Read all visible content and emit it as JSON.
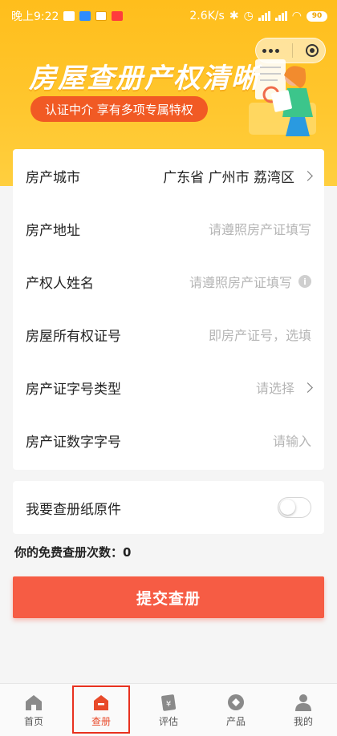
{
  "status_bar": {
    "time": "晚上9:22",
    "network_speed": "2.6K/s",
    "battery": "90"
  },
  "banner": {
    "title": "房屋查册产权清晰",
    "subtitle": "认证中介 享有多项专属特权"
  },
  "form": {
    "rows": [
      {
        "label": "房产城市",
        "value": "广东省 广州市 荔湾区",
        "filled": true
      },
      {
        "label": "房产地址",
        "placeholder": "请遵照房产证填写"
      },
      {
        "label": "产权人姓名",
        "placeholder": "请遵照房产证填写"
      },
      {
        "label": "房屋所有权证号",
        "placeholder": "即房产证号，选填"
      },
      {
        "label": "房产证字号类型",
        "placeholder": "请选择"
      },
      {
        "label": "房产证数字字号",
        "placeholder": "请输入"
      }
    ]
  },
  "toggle": {
    "label": "我要查册纸原件",
    "on": false
  },
  "free_count_text": "你的免费查册次数：0",
  "submit_label": "提交查册",
  "tabbar": {
    "items": [
      {
        "label": "首页",
        "icon": "home-icon"
      },
      {
        "label": "查册",
        "icon": "house-check-icon",
        "active": true
      },
      {
        "label": "评估",
        "icon": "yen-card-icon"
      },
      {
        "label": "产品",
        "icon": "product-icon"
      },
      {
        "label": "我的",
        "icon": "user-icon"
      }
    ]
  },
  "colors": {
    "banner": "#ffc62d",
    "accent": "#f65c44",
    "active_tab": "#e84a2a"
  }
}
